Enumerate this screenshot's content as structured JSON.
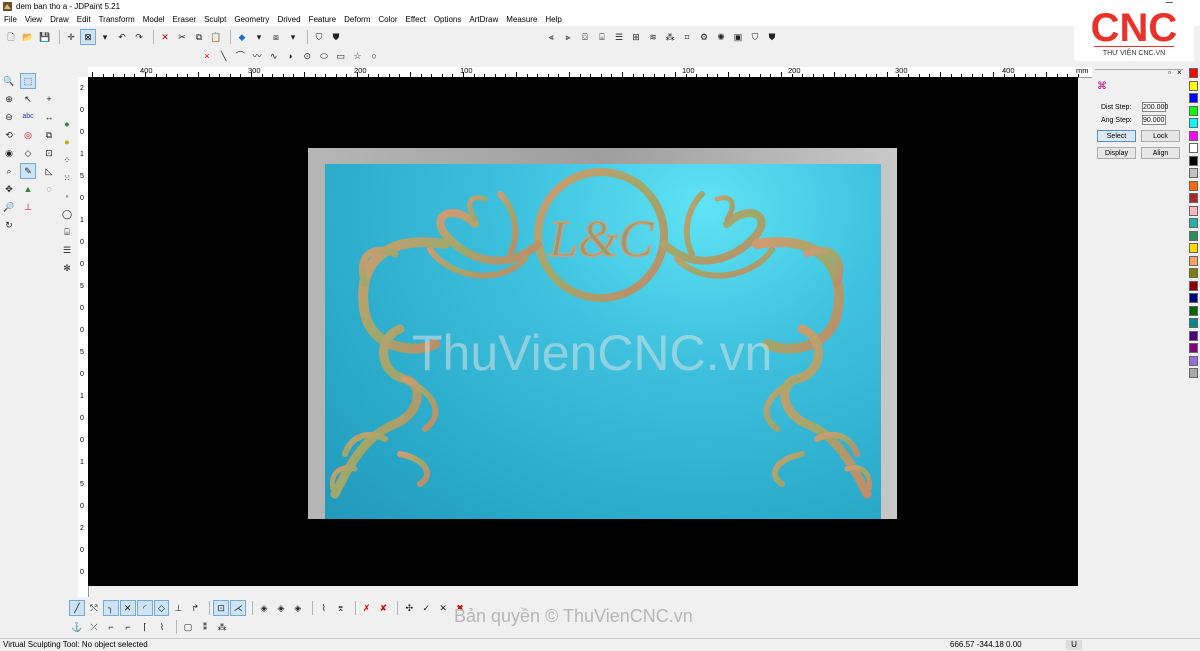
{
  "window": {
    "title": "dem ban tho a - JDPaint 5.21",
    "controls": [
      "–",
      "❐",
      "✕"
    ]
  },
  "menu": [
    "File",
    "View",
    "Draw",
    "Edit",
    "Transform",
    "Model",
    "Eraser",
    "Sculpt",
    "Geometry",
    "Drived",
    "Feature",
    "Deform",
    "Color",
    "Effect",
    "Options",
    "ArtDraw",
    "Measure",
    "Help"
  ],
  "logo": {
    "brand": "CNC",
    "subtitle": "THƯ VIỆN CNC.VN",
    "color": "#e8322b"
  },
  "ruler": {
    "h_labels": [
      "400",
      "300",
      "200",
      "100",
      "100",
      "200",
      "300",
      "400"
    ],
    "unit": "mm",
    "v_labels": [
      "2",
      "0",
      "0",
      "1",
      "5",
      "0",
      "1",
      "0",
      "0",
      "5",
      "0",
      "0",
      "5",
      "0",
      "1",
      "0",
      "0",
      "1",
      "5",
      "0",
      "2",
      "0",
      "0"
    ]
  },
  "canvas": {
    "watermark": "ThuVienCNC.vn",
    "monogram": "L&C"
  },
  "copyright": "Bản quyền © ThuVienCNC.vn",
  "panel": {
    "dist_step_label": "Dist Step:",
    "dist_step_value": "200.000",
    "ang_step_label": "Ang Step:",
    "ang_step_value": "90.000",
    "buttons": {
      "select": "Select",
      "lock": "Lock",
      "display": "Display",
      "align": "Align"
    }
  },
  "palette": [
    "#ff0000",
    "#ffff00",
    "#0000ff",
    "#00ff00",
    "#00ffff",
    "#ff00ff",
    "#ffffff",
    "#000000",
    "#c0c0c0",
    "#ff6a00",
    "#a52a2a",
    "#ffb6c1",
    "#20b2aa",
    "#2e8b57",
    "#ffd700",
    "#f4a460",
    "#808000",
    "#8b0000",
    "#000080",
    "#006400",
    "#008b8b",
    "#4b0082",
    "#800080",
    "#9370db",
    "#a9a9a9"
  ],
  "status": {
    "message": "Virtual Sculpting Tool: No object selected",
    "coords": "666.57 -344.18 0.00",
    "mode": "U"
  }
}
